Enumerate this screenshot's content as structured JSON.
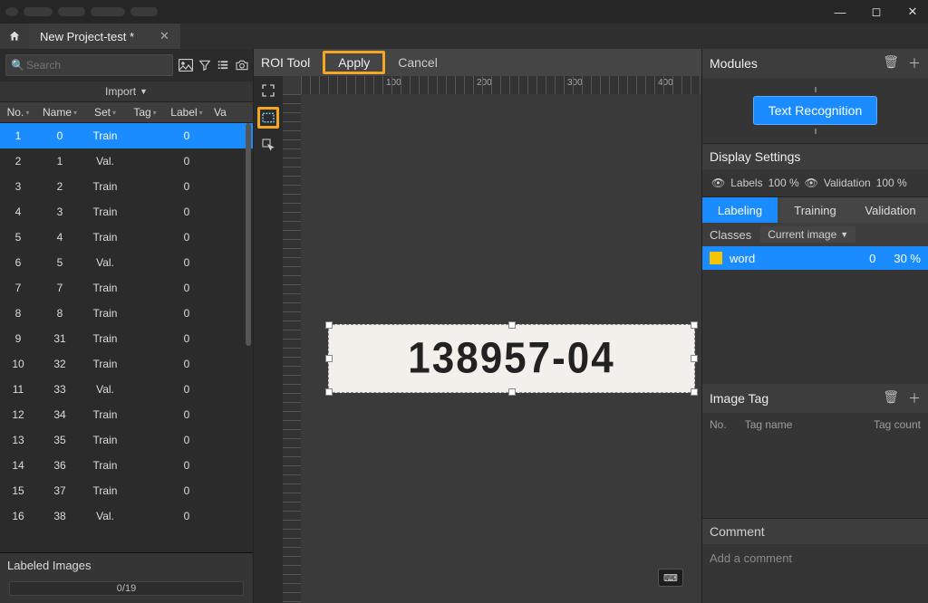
{
  "project_tab": "New Project-test *",
  "search_placeholder": "Search",
  "left": {
    "import_label": "Import",
    "columns": {
      "no": "No.",
      "name": "Name",
      "set": "Set",
      "tag": "Tag",
      "label": "Label",
      "va": "Va"
    },
    "rows": [
      {
        "no": "1",
        "name": "0",
        "set": "Train",
        "tag": "",
        "label": "0",
        "sel": true
      },
      {
        "no": "2",
        "name": "1",
        "set": "Val.",
        "tag": "",
        "label": "0"
      },
      {
        "no": "3",
        "name": "2",
        "set": "Train",
        "tag": "",
        "label": "0"
      },
      {
        "no": "4",
        "name": "3",
        "set": "Train",
        "tag": "",
        "label": "0"
      },
      {
        "no": "5",
        "name": "4",
        "set": "Train",
        "tag": "",
        "label": "0"
      },
      {
        "no": "6",
        "name": "5",
        "set": "Val.",
        "tag": "",
        "label": "0"
      },
      {
        "no": "7",
        "name": "7",
        "set": "Train",
        "tag": "",
        "label": "0"
      },
      {
        "no": "8",
        "name": "8",
        "set": "Train",
        "tag": "",
        "label": "0"
      },
      {
        "no": "9",
        "name": "31",
        "set": "Train",
        "tag": "",
        "label": "0"
      },
      {
        "no": "10",
        "name": "32",
        "set": "Train",
        "tag": "",
        "label": "0"
      },
      {
        "no": "11",
        "name": "33",
        "set": "Val.",
        "tag": "",
        "label": "0"
      },
      {
        "no": "12",
        "name": "34",
        "set": "Train",
        "tag": "",
        "label": "0"
      },
      {
        "no": "13",
        "name": "35",
        "set": "Train",
        "tag": "",
        "label": "0"
      },
      {
        "no": "14",
        "name": "36",
        "set": "Train",
        "tag": "",
        "label": "0"
      },
      {
        "no": "15",
        "name": "37",
        "set": "Train",
        "tag": "",
        "label": "0"
      },
      {
        "no": "16",
        "name": "38",
        "set": "Val.",
        "tag": "",
        "label": "0"
      }
    ],
    "labeled_head": "Labeled Images",
    "progress": "0/19"
  },
  "center": {
    "tool_label": "ROI Tool",
    "apply": "Apply",
    "cancel": "Cancel",
    "ruler_ticks": [
      "100",
      "200",
      "300",
      "400"
    ],
    "image_text": "138957-04"
  },
  "right": {
    "modules_head": "Modules",
    "module_btn": "Text Recognition",
    "display_head": "Display Settings",
    "labels_label": "Labels",
    "labels_pct": "100 %",
    "validation_label": "Validation",
    "validation_pct": "100 %",
    "tabs": {
      "labeling": "Labeling",
      "training": "Training",
      "validation": "Validation"
    },
    "classes_head": "Classes",
    "classes_scope": "Current image",
    "class": {
      "name": "word",
      "count": "0",
      "pct": "30 %",
      "color": "#f5c400"
    },
    "imgtag_head": "Image Tag",
    "imgtag_cols": {
      "no": "No.",
      "name": "Tag name",
      "count": "Tag count"
    },
    "comment_head": "Comment",
    "comment_placeholder": "Add a comment"
  }
}
